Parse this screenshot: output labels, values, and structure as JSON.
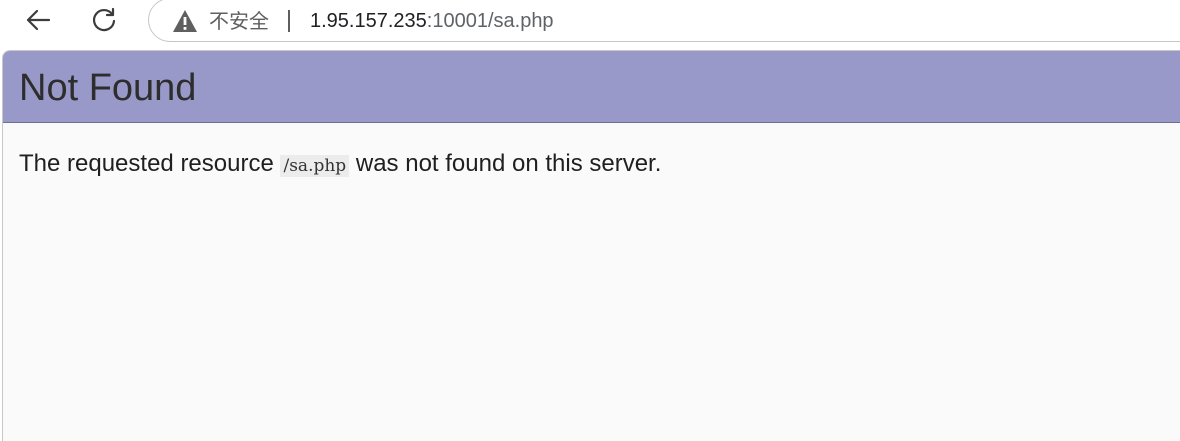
{
  "browser": {
    "back_icon": "arrow-left-icon",
    "reload_icon": "reload-icon",
    "security_icon": "warning-triangle-icon",
    "security_label": "不安全",
    "url_host": "1.95.157.235",
    "url_rest": ":10001/sa.php"
  },
  "page": {
    "title": "Not Found",
    "message_before": "The requested resource ",
    "resource_path": "/sa.php",
    "message_after": " was not found on this server.",
    "banner_color": "#9999c9",
    "background_color": "#fafafa"
  }
}
